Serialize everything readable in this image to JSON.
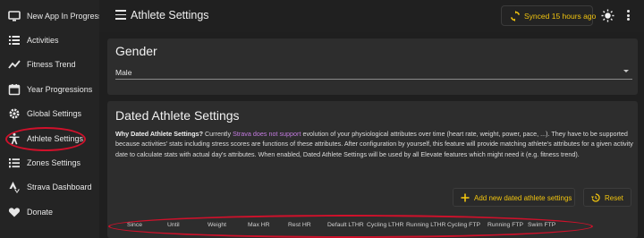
{
  "sidebar": {
    "items": [
      {
        "label": "New App In Progress",
        "icon": "monitor-icon"
      },
      {
        "label": "Activities",
        "icon": "list-icon"
      },
      {
        "label": "Fitness Trend",
        "icon": "trend-icon"
      },
      {
        "label": "Year Progressions",
        "icon": "calendar-icon"
      },
      {
        "label": "Global Settings",
        "icon": "gear-icon"
      },
      {
        "label": "Athlete Settings",
        "icon": "accessibility-icon"
      },
      {
        "label": "Zones Settings",
        "icon": "ordered-list-icon"
      },
      {
        "label": "Strava Dashboard",
        "icon": "strava-icon"
      },
      {
        "label": "Donate",
        "icon": "heart-icon"
      }
    ]
  },
  "header": {
    "title": "Athlete Settings",
    "sync_label": "Synced 15 hours ago"
  },
  "gender": {
    "title": "Gender",
    "value": "Male"
  },
  "dated": {
    "title": "Dated Athlete Settings",
    "desc_bold": "Why Dated Athlete Settings?",
    "desc_pre": " Currently ",
    "desc_link": "Strava does not support",
    "desc_post": " evolution of your physiological attributes over time (heart rate, weight, power, pace, ...). They have to be supported because activities' stats including stress scores are functions of these attributes. After configuration by yourself, this feature will provide matching athlete's attributes for a given activity date to calculate stats with actual day's attributes. When enabled, Dated Athlete Settings will be used by all Elevate features which might need it (e.g. fitness trend).",
    "add_label": "Add new dated athlete settings",
    "reset_label": "Reset",
    "columns": [
      "Since",
      "Until",
      "Weight",
      "Max HR",
      "Rest HR",
      "Default LTHR",
      "Cycling LTHR",
      "Running LTHR",
      "Cycling FTP",
      "Running FTP",
      "Swim FTP"
    ]
  },
  "colors": {
    "accent": "#f1c40f",
    "link": "#c47be0",
    "annotation": "#d0112b"
  }
}
